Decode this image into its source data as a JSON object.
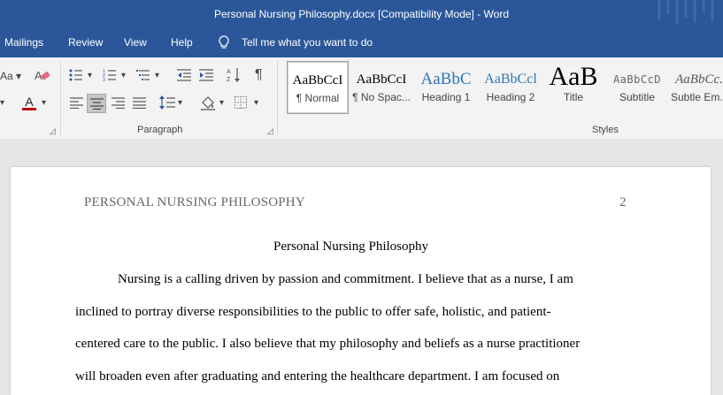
{
  "window": {
    "title": "Personal Nursing Philosophy.docx [Compatibility Mode]  -  Word"
  },
  "menu": {
    "mailings": "Mailings",
    "review": "Review",
    "view": "View",
    "help": "Help",
    "tell_me": "Tell me what you want to do"
  },
  "ribbon": {
    "font_case": "Aa",
    "paragraph_label": "Paragraph",
    "styles_label": "Styles",
    "styles": [
      {
        "preview": "AaBbCcI",
        "name": "¶ Normal"
      },
      {
        "preview": "AaBbCcI",
        "name": "¶ No Spac..."
      },
      {
        "preview": "AaBbC",
        "name": "Heading 1"
      },
      {
        "preview": "AaBbCcl",
        "name": "Heading 2"
      },
      {
        "preview": "AaB",
        "name": "Title"
      },
      {
        "preview": "AaBbCcD",
        "name": "Subtitle"
      },
      {
        "preview": "AaBbCc.",
        "name": "Subtle Em..."
      }
    ]
  },
  "document": {
    "header_text": "PERSONAL NURSING PHILOSOPHY",
    "page_number": "2",
    "title": "Personal Nursing Philosophy",
    "lines": [
      "Nursing is a calling driven by passion and commitment. I believe that as a nurse, I am",
      "inclined to portray diverse responsibilities to the public to offer safe, holistic, and patient-",
      "centered care to the public. I also believe that my philosophy and beliefs as a nurse practitioner",
      "will broaden even after graduating and entering the healthcare department. I am focused on"
    ]
  },
  "colors": {
    "word_blue": "#2b579a",
    "ribbon_bg": "#f3f3f3",
    "canvas_bg": "#e6e6e6",
    "font_color_red": "#c00000"
  }
}
